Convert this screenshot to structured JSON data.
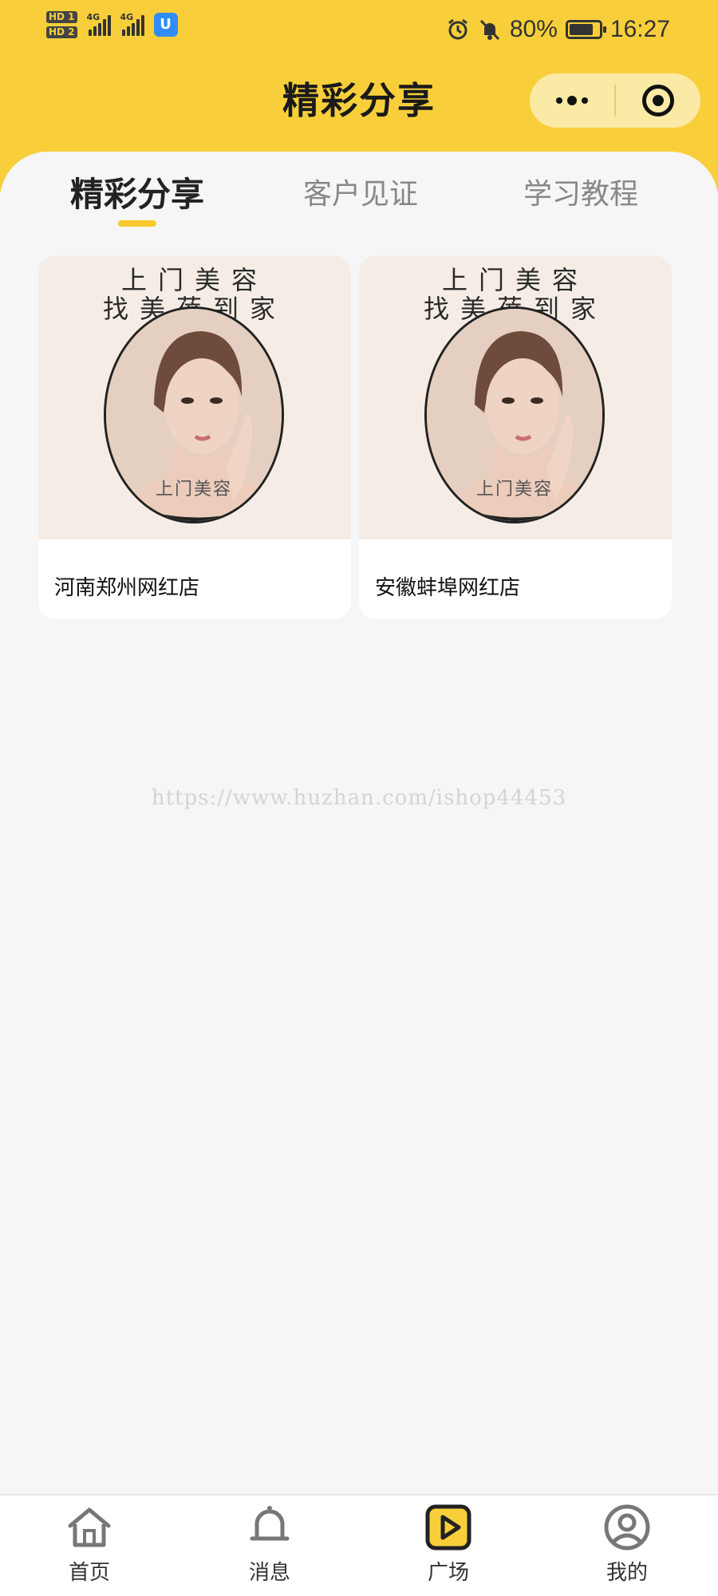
{
  "status_bar": {
    "sim1": "HD 1",
    "sim2": "HD 2",
    "net1": "4G",
    "net2": "4G",
    "battery_pct_text": "80%",
    "battery_level": 0.8,
    "time": "16:27"
  },
  "nav": {
    "title": "精彩分享"
  },
  "tabs": [
    {
      "label": "精彩分享",
      "active": true
    },
    {
      "label": "客户见证",
      "active": false
    },
    {
      "label": "学习教程",
      "active": false
    }
  ],
  "cards": [
    {
      "poster_line1": "上门美容",
      "poster_line2": "找美蓓到家",
      "poster_caption": "上门美容",
      "title": "河南郑州网红店"
    },
    {
      "poster_line1": "上门美容",
      "poster_line2": "找美蓓到家",
      "poster_caption": "上门美容",
      "title": "安徽蚌埠网红店"
    }
  ],
  "watermark": "https://www.huzhan.com/ishop44453",
  "tabbar": [
    {
      "label": "首页",
      "icon": "home-icon",
      "active": false
    },
    {
      "label": "消息",
      "icon": "bell-icon",
      "active": false
    },
    {
      "label": "广场",
      "icon": "play-square-icon",
      "active": true
    },
    {
      "label": "我的",
      "icon": "user-circle-icon",
      "active": false
    }
  ],
  "colors": {
    "brand_yellow": "#f8cf3b",
    "tab_underline": "#f8c92c"
  }
}
